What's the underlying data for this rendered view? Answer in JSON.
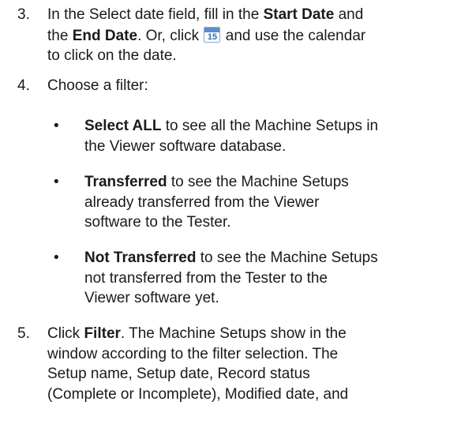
{
  "steps": {
    "step3": {
      "number": "3.",
      "line1_pre": "In the Select date field, fill in the ",
      "start_date": "Start Date",
      "line1_post": " and",
      "line2_pre": "the ",
      "end_date": "End Date",
      "line2_mid": ". Or, click ",
      "calendar_icon": {
        "icon": "calendar-icon",
        "day": "15",
        "color": "#5b8fd0"
      },
      "line2_post": " and use the calendar",
      "line3": "to click on the date."
    },
    "step4": {
      "number": "4.",
      "text": "Choose a filter:",
      "bullet_glyph": "•",
      "bullets": [
        {
          "term": "Select ALL",
          "line1": " to see all the Machine Setups in",
          "line2": "the Viewer software database."
        },
        {
          "term": "Transferred",
          "line1": " to see the Machine Setups",
          "line2": "already transferred from the Viewer",
          "line3": "software to the Tester."
        },
        {
          "term": "Not Transferred",
          "line1": " to see the Machine Setups",
          "line2": "not transferred from the Tester to the",
          "line3": "Viewer software yet."
        }
      ]
    },
    "step5": {
      "number": "5.",
      "line1_pre": "Click ",
      "filter_label": "Filter",
      "line1_post": ". The Machine Setups show in the",
      "line2": "window according to the filter selection. The",
      "line3": "Setup name, Setup date, Record status",
      "line4": "(Complete or Incomplete), Modified date, and"
    }
  }
}
